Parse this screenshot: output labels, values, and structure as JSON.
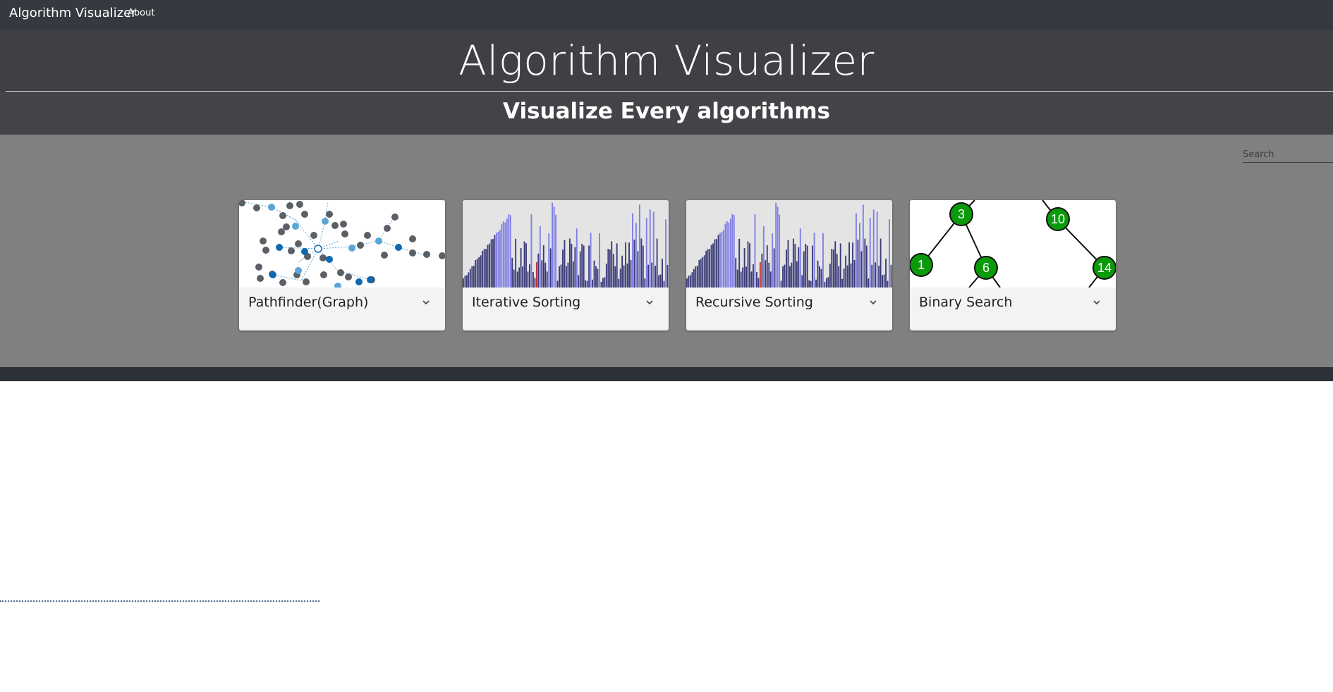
{
  "navbar": {
    "brand": "Algorithm Visualizer",
    "about_link": "About"
  },
  "hero": {
    "title": "Algorithm Visualizer",
    "subtitle": "Visualize Every algorithms"
  },
  "search": {
    "placeholder": "Search"
  },
  "cards": [
    {
      "title": "Pathfinder(Graph)",
      "image": "graph-network-image"
    },
    {
      "title": "Iterative Sorting",
      "image": "bar-sorting-image"
    },
    {
      "title": "Recursive Sorting",
      "image": "bar-sorting-image"
    },
    {
      "title": "Binary Search",
      "image": "binary-tree-image",
      "node_labels": [
        "3",
        "10",
        "1",
        "6",
        "14"
      ]
    }
  ],
  "colors": {
    "navbar": "#343a40",
    "hero": "#3f4043",
    "main": "#808080",
    "footer": "#2c3038",
    "node_green": "#0a9a0a",
    "bar_dark": "#3a3a78",
    "bar_light": "#7f7fe6",
    "bar_active": "#c0303a"
  },
  "icons": {
    "card_expand": "chevron-down-icon"
  }
}
